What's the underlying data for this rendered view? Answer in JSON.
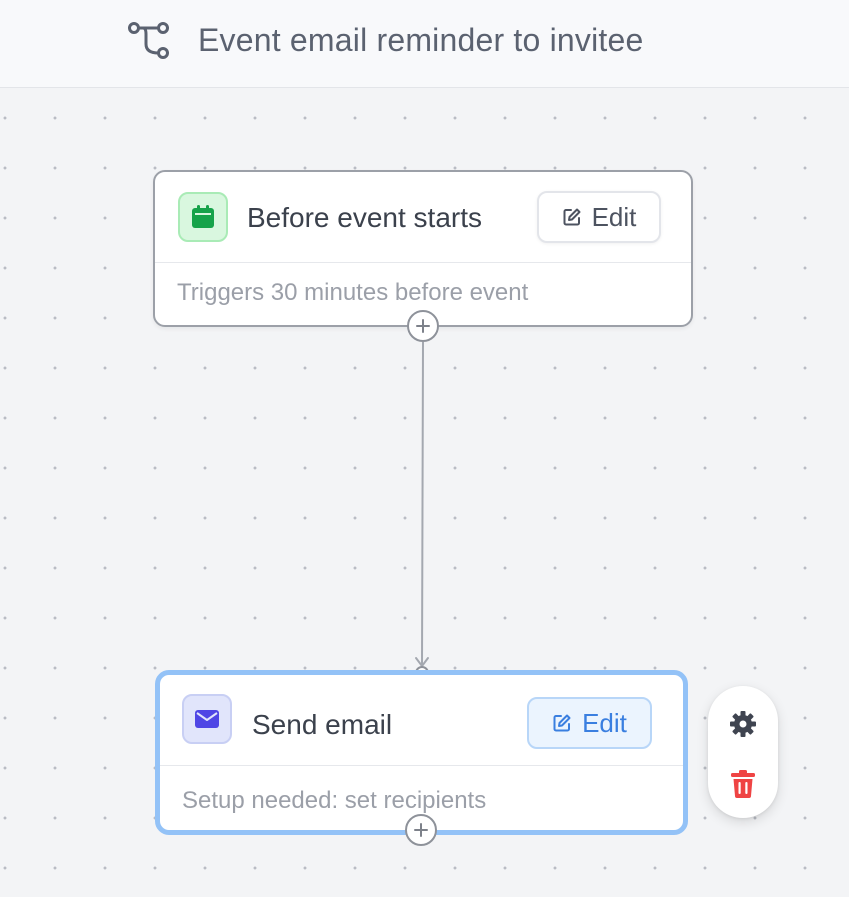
{
  "header": {
    "title": "Event email reminder to invitee",
    "icon": "workflow-branch-icon"
  },
  "nodes": {
    "trigger": {
      "title": "Before event starts",
      "edit_label": "Edit",
      "description": "Triggers 30 minutes before event",
      "icon": "calendar-icon",
      "icon_color": "#16a34a"
    },
    "action": {
      "title": "Send email",
      "edit_label": "Edit",
      "description": "Setup needed: set recipients",
      "icon": "mail-icon",
      "icon_color": "#4f46e5"
    }
  },
  "toolbar": {
    "items": [
      "gear-icon",
      "trash-icon"
    ],
    "gear_color": "#3f4450",
    "trash_color": "#ef4444"
  },
  "colors": {
    "selected_border": "#93c2f7",
    "edit_active_text": "#3a7fe0"
  }
}
